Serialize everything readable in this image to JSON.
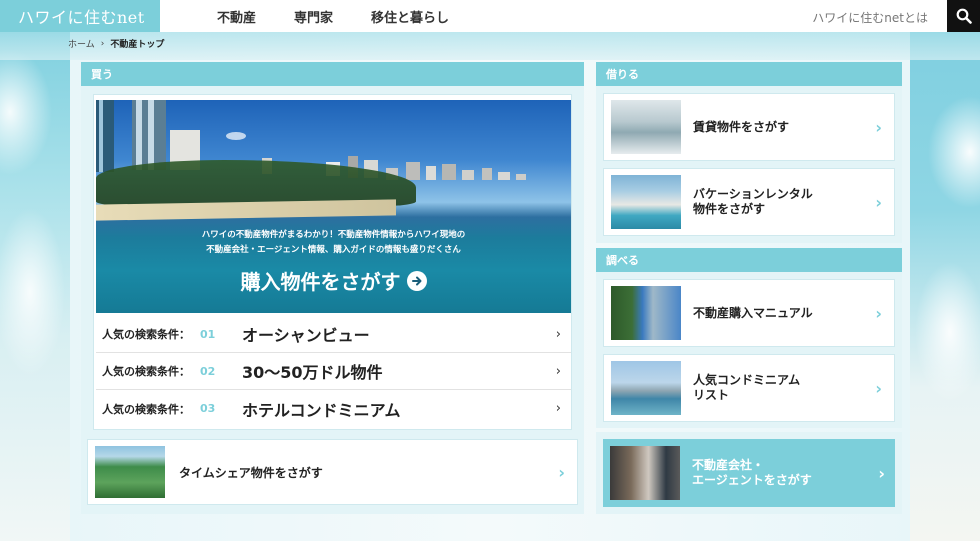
{
  "header": {
    "logo": "ハワイに住むnet",
    "nav": [
      "不動産",
      "専門家",
      "移住と暮らし"
    ],
    "about_link": "ハワイに住むnetとは",
    "search_icon": "search-icon"
  },
  "breadcrumb": {
    "home": "ホーム",
    "separator": "›",
    "current": "不動産トップ"
  },
  "buy": {
    "heading": "買う",
    "hero_line1": "ハワイの不動産物件がまるわかり！不動産物件情報からハワイ現地の",
    "hero_line2": "不動産会社・エージェント情報、購入ガイドの情報も盛りだくさん",
    "hero_cta": "購入物件をさがす",
    "conditions": [
      {
        "label": "人気の検索条件：",
        "num": "01",
        "value": "オーシャンビュー"
      },
      {
        "label": "人気の検索条件：",
        "num": "02",
        "value": "30〜50万ドル物件"
      },
      {
        "label": "人気の検索条件：",
        "num": "03",
        "value": "ホテルコンドミニアム"
      }
    ],
    "timeshare": "タイムシェア物件をさがす"
  },
  "rent": {
    "heading": "借りる",
    "items": [
      "賃貸物件をさがす",
      "バケーションレンタル\n物件をさがす"
    ]
  },
  "research": {
    "heading": "調べる",
    "items": [
      "不動産購入マニュアル",
      "人気コンドミニアム\nリスト"
    ]
  },
  "agent": {
    "label": "不動産会社・\nエージェントをさがす"
  },
  "colors": {
    "accent": "#7ccfda",
    "panel_bg": "#e3f4f7",
    "header_bg": "#ffffff",
    "search_bg": "#111111"
  }
}
